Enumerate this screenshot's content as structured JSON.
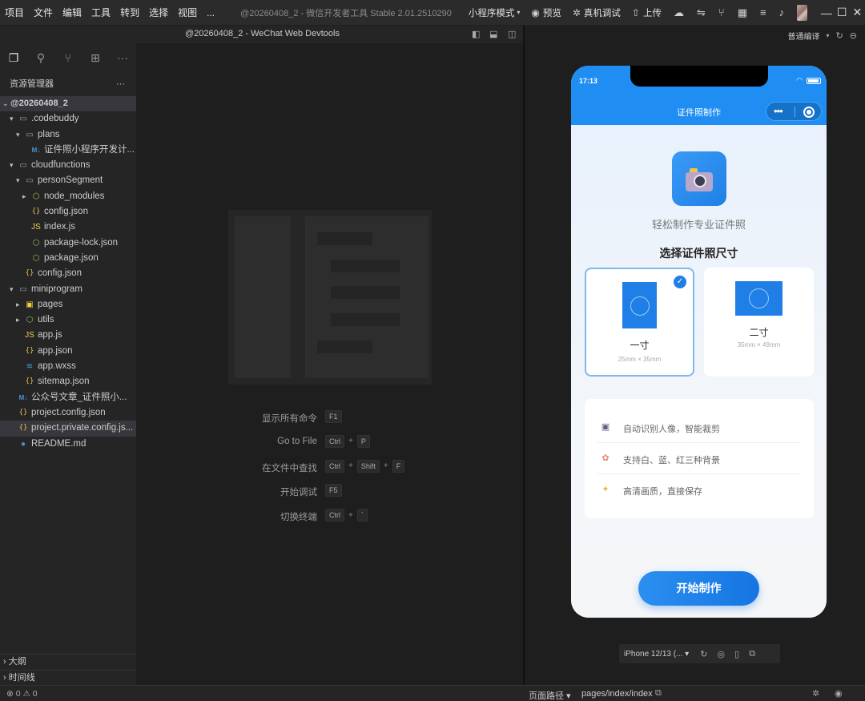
{
  "menubar": {
    "items": [
      "项目",
      "文件",
      "编辑",
      "工具",
      "转到",
      "选择",
      "视图",
      "..."
    ],
    "app_title": "@20260408_2 - 微信开发者工具 Stable 2.01.2510290",
    "mode": "小程序模式",
    "preview": "预览",
    "realtest": "真机调试",
    "upload": "上传"
  },
  "editor_header": {
    "title": "@20260408_2 - WeChat Web Devtools"
  },
  "explorer": {
    "title": "资源管理器",
    "more": "···",
    "root": "@20260408_2",
    "items": [
      {
        "label": ".codebuddy",
        "type": "folder",
        "open": true
      },
      {
        "label": "plans",
        "type": "folder",
        "open": true
      },
      {
        "label": "证件照小程序开发计...",
        "type": "md"
      },
      {
        "label": "cloudfunctions",
        "type": "folder",
        "open": true
      },
      {
        "label": "personSegment",
        "type": "folder",
        "open": true
      },
      {
        "label": "node_modules",
        "type": "node",
        "open": false
      },
      {
        "label": "config.json",
        "type": "json"
      },
      {
        "label": "index.js",
        "type": "js"
      },
      {
        "label": "package-lock.json",
        "type": "node"
      },
      {
        "label": "package.json",
        "type": "node"
      },
      {
        "label": "config.json",
        "type": "json"
      },
      {
        "label": "miniprogram",
        "type": "folder",
        "open": true
      },
      {
        "label": "pages",
        "type": "pages",
        "open": false
      },
      {
        "label": "utils",
        "type": "node",
        "open": false
      },
      {
        "label": "app.js",
        "type": "js"
      },
      {
        "label": "app.json",
        "type": "json"
      },
      {
        "label": "app.wxss",
        "type": "css"
      },
      {
        "label": "sitemap.json",
        "type": "json"
      },
      {
        "label": "公众号文章_证件照小...",
        "type": "md"
      },
      {
        "label": "project.config.json",
        "type": "json"
      },
      {
        "label": "project.private.config.js...",
        "type": "json"
      },
      {
        "label": "README.md",
        "type": "info"
      }
    ],
    "outline": "大纲",
    "timeline": "时间线"
  },
  "shortcuts": [
    {
      "label": "显示所有命令",
      "keys": [
        "F1"
      ]
    },
    {
      "label": "Go to File",
      "keys": [
        "Ctrl",
        "P"
      ]
    },
    {
      "label": "在文件中查找",
      "keys": [
        "Ctrl",
        "Shift",
        "F"
      ]
    },
    {
      "label": "开始调试",
      "keys": [
        "F5"
      ]
    },
    {
      "label": "切换终端",
      "keys": [
        "Ctrl",
        "`"
      ]
    }
  ],
  "simulator": {
    "compile_mode": "普通编译",
    "status_time": "17:13",
    "nav_title": "证件照制作",
    "hero_subtitle": "轻松制作专业证件照",
    "section_title": "选择证件照尺寸",
    "sizes": [
      {
        "name": "一寸",
        "dim": "25mm × 35mm",
        "selected": true
      },
      {
        "name": "二寸",
        "dim": "35mm × 49mm",
        "selected": false
      }
    ],
    "features": [
      {
        "icon": "camera-icon",
        "text": "自动识别人像，智能裁剪"
      },
      {
        "icon": "palette-icon",
        "text": "支持白、蓝、红三种背景"
      },
      {
        "icon": "sparkle-icon",
        "text": "高清画质，直接保存"
      }
    ],
    "start_button": "开始制作",
    "device": "iPhone 12/13 (... ▾",
    "accent": "#1f7fe6"
  },
  "statusbar": {
    "problems": "⊗ 0 ⚠ 0",
    "path_label": "页面路径 ▾",
    "path": "pages/index/index"
  }
}
